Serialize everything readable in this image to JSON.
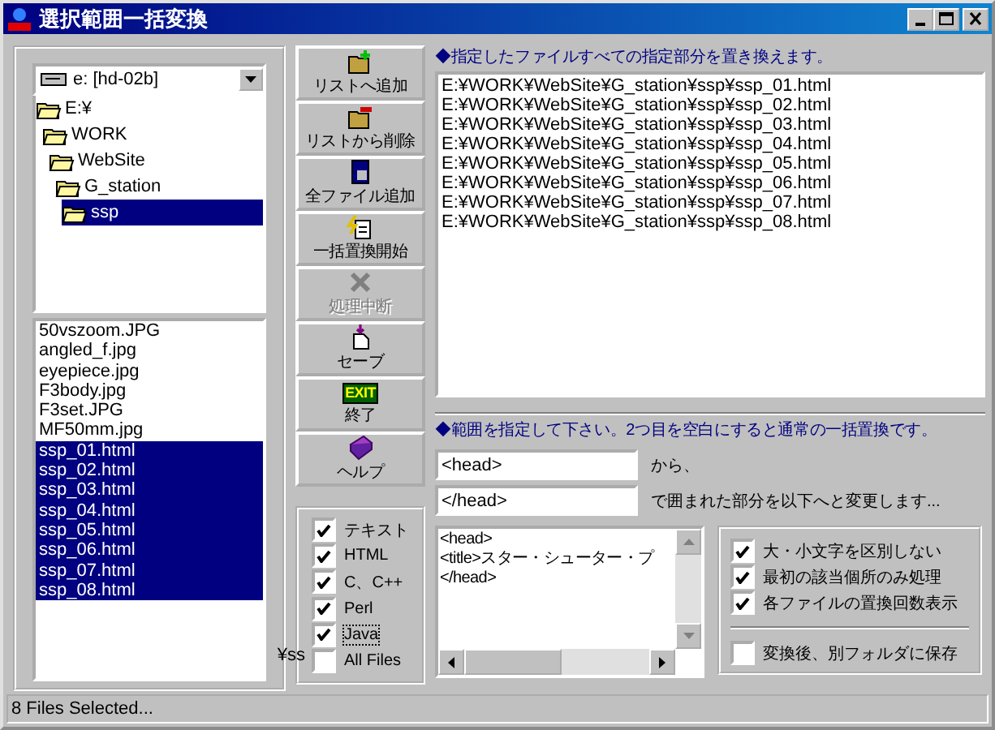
{
  "window": {
    "title": "選択範囲一括変換"
  },
  "drive_select": {
    "value": "e: [hd-02b]"
  },
  "folder_tree": [
    {
      "label": "E:¥",
      "selected": false,
      "children": [
        {
          "label": "WORK",
          "selected": false,
          "children": [
            {
              "label": "WebSite",
              "selected": false,
              "children": [
                {
                  "label": "G_station",
                  "selected": false,
                  "children": [
                    {
                      "label": "ssp",
                      "selected": true
                    }
                  ]
                }
              ]
            }
          ]
        }
      ]
    }
  ],
  "file_list": [
    {
      "name": "50vszoom.JPG",
      "selected": false
    },
    {
      "name": "angled_f.jpg",
      "selected": false
    },
    {
      "name": "eyepiece.jpg",
      "selected": false
    },
    {
      "name": "F3body.jpg",
      "selected": false
    },
    {
      "name": "F3set.JPG",
      "selected": false
    },
    {
      "name": "MF50mm.jpg",
      "selected": false
    },
    {
      "name": "ssp_01.html",
      "selected": true
    },
    {
      "name": "ssp_02.html",
      "selected": true
    },
    {
      "name": "ssp_03.html",
      "selected": true
    },
    {
      "name": "ssp_04.html",
      "selected": true
    },
    {
      "name": "ssp_05.html",
      "selected": true
    },
    {
      "name": "ssp_06.html",
      "selected": true
    },
    {
      "name": "ssp_07.html",
      "selected": true
    },
    {
      "name": "ssp_08.html",
      "selected": true
    }
  ],
  "path_fragment": "¥ss",
  "buttons": [
    {
      "kind": "add",
      "label": "リストへ追加",
      "disabled": false
    },
    {
      "kind": "remove",
      "label": "リストから削除",
      "disabled": false
    },
    {
      "kind": "add_all",
      "label": "全ファイル追加",
      "disabled": false
    },
    {
      "kind": "start",
      "label": "一括置換開始",
      "disabled": false
    },
    {
      "kind": "stop",
      "label": "処理中断",
      "disabled": true
    },
    {
      "kind": "save",
      "label": "セーブ",
      "disabled": false
    },
    {
      "kind": "exit",
      "label": "終了",
      "icon_text": "EXIT",
      "disabled": false
    },
    {
      "kind": "help",
      "label": "ヘルプ",
      "disabled": false
    }
  ],
  "file_types": [
    {
      "label": "テキスト",
      "checked": true,
      "focused": false
    },
    {
      "label": "HTML",
      "checked": true,
      "focused": false
    },
    {
      "label": "C、C++",
      "checked": true,
      "focused": false
    },
    {
      "label": "Perl",
      "checked": true,
      "focused": false
    },
    {
      "label": "Java",
      "checked": true,
      "focused": true
    },
    {
      "label": "All Files",
      "checked": false,
      "focused": false
    }
  ],
  "target_list": {
    "heading": "◆指定したファイルすべての指定部分を置き換えます。",
    "paths": [
      "E:¥WORK¥WebSite¥G_station¥ssp¥ssp_01.html",
      "E:¥WORK¥WebSite¥G_station¥ssp¥ssp_02.html",
      "E:¥WORK¥WebSite¥G_station¥ssp¥ssp_03.html",
      "E:¥WORK¥WebSite¥G_station¥ssp¥ssp_04.html",
      "E:¥WORK¥WebSite¥G_station¥ssp¥ssp_05.html",
      "E:¥WORK¥WebSite¥G_station¥ssp¥ssp_06.html",
      "E:¥WORK¥WebSite¥G_station¥ssp¥ssp_07.html",
      "E:¥WORK¥WebSite¥G_station¥ssp¥ssp_08.html"
    ]
  },
  "range": {
    "heading": "◆範囲を指定して下さい。2つ目を空白にすると通常の一括置換です。",
    "start": {
      "value": "<head>",
      "suffix": "から、"
    },
    "end": {
      "value": "</head>",
      "suffix": "で囲まれた部分を以下へと変更します..."
    },
    "replacement": [
      "<head>",
      "<title>スター・シューター・プ",
      "</head>"
    ]
  },
  "options": [
    {
      "label": "大・小文字を区別しない",
      "checked": true
    },
    {
      "label": "最初の該当個所のみ処理",
      "checked": true
    },
    {
      "label": "各ファイルの置換回数表示",
      "checked": true
    }
  ],
  "save_option": {
    "label": "変換後、別フォルダに保存",
    "checked": false
  },
  "status_bar": "8 Files Selected..."
}
